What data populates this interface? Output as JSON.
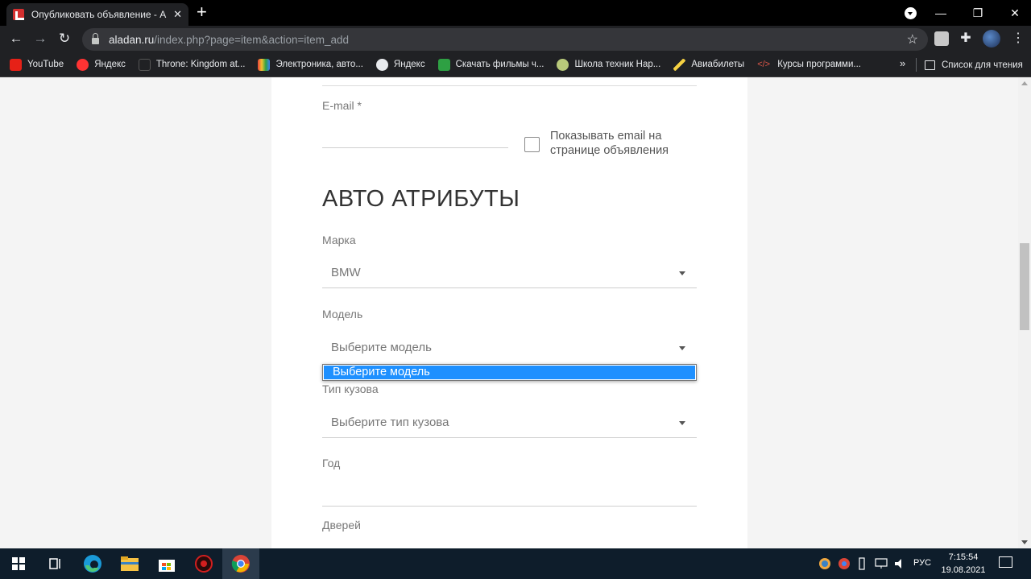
{
  "browser": {
    "tab_title": "Опубликовать объявление - Ala",
    "tab_close": "✕",
    "new_tab": "+",
    "url_host": "aladan.ru",
    "url_path": "/index.php?page=item&action=item_add",
    "back": "←",
    "forward": "→",
    "reload": "↻",
    "bookmarks": [
      {
        "label": "YouTube",
        "color": "#e62117"
      },
      {
        "label": "Яндекс",
        "color": "#ff3333"
      },
      {
        "label": "Throne: Kingdom at...",
        "color": "#202124"
      },
      {
        "label": "Электроника, авто...",
        "color": "#f2c230"
      },
      {
        "label": "Яндекс",
        "color": "#e8eaed"
      },
      {
        "label": "Скачать фильмы ч...",
        "color": "#2ea043"
      },
      {
        "label": "Школа техник Нар...",
        "color": "#b8c97a"
      },
      {
        "label": "Авиабилеты",
        "color": "#f5d142"
      },
      {
        "label": "Курсы программи...",
        "color": "#e0584a"
      }
    ],
    "bookmarks_more": "»",
    "reading_list": "Список для чтения"
  },
  "form": {
    "email_label": "E-mail *",
    "show_email_label": "Показывать email на странице объявления",
    "section_title": "АВТО АТРИБУТЫ",
    "brand_label": "Марка",
    "brand_value": "BMW",
    "model_label": "Модель",
    "model_value": "Выберите модель",
    "model_dropdown_option": "Выберите модель",
    "body_type_label": "Тип кузова",
    "body_type_value": "Выберите тип кузова",
    "year_label": "Год",
    "doors_label": "Дверей"
  },
  "taskbar": {
    "lang": "РУС",
    "time": "7:15:54",
    "date": "19.08.2021"
  }
}
